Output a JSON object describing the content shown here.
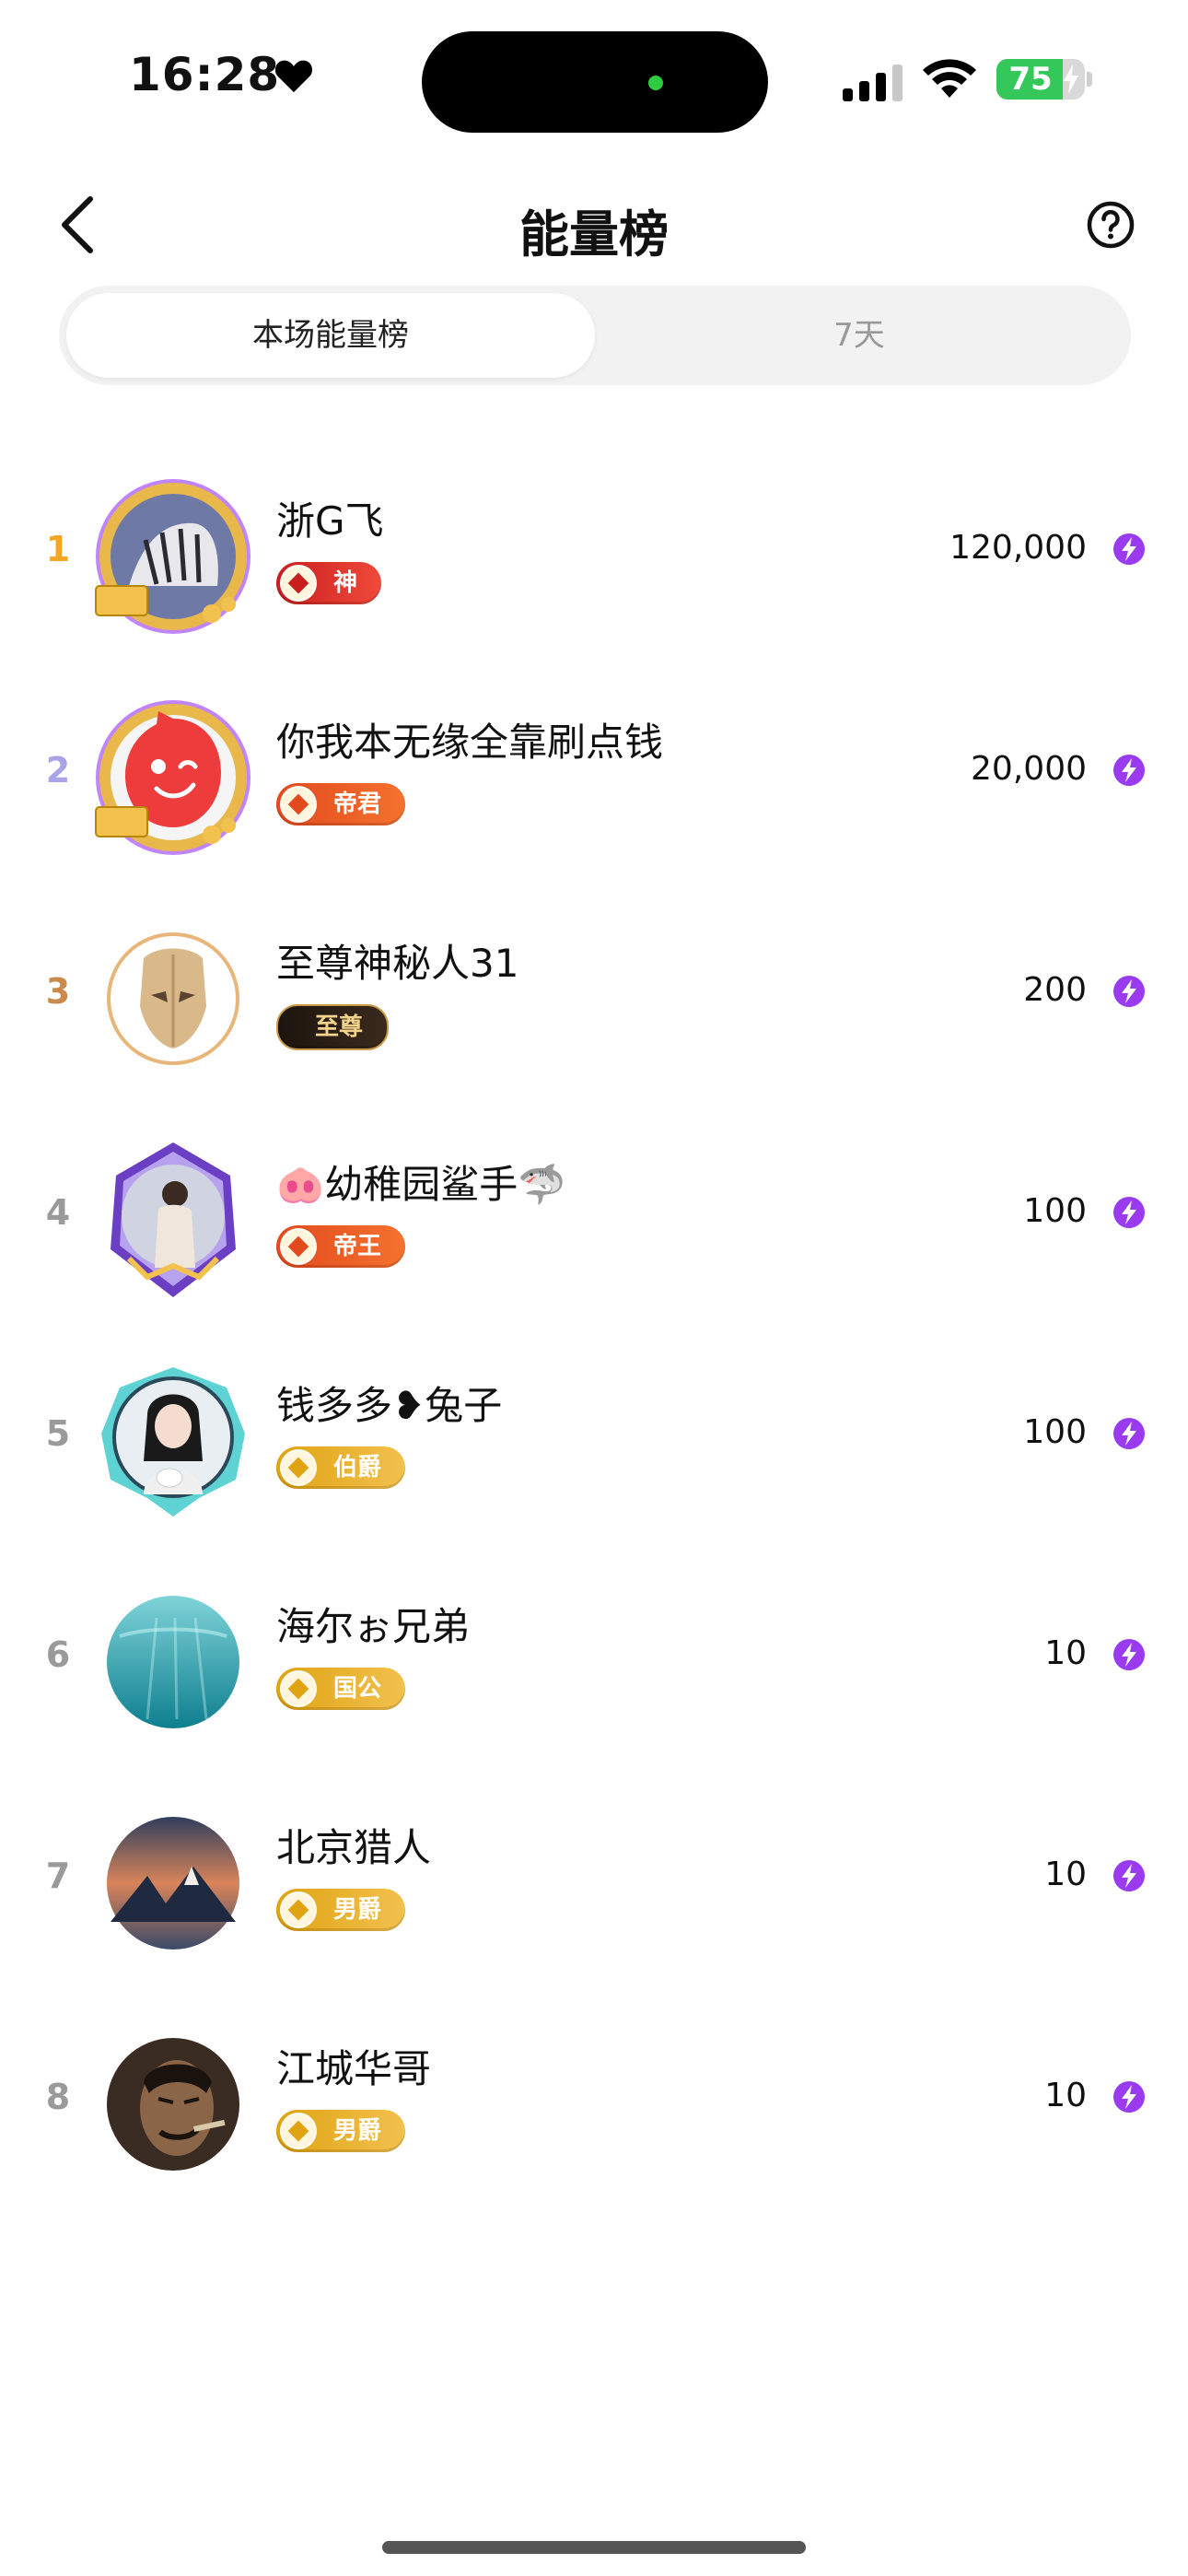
{
  "status_bar": {
    "time": "16:28",
    "battery": "75",
    "battery_level": 0.75
  },
  "header": {
    "title": "能量榜"
  },
  "tabs": [
    {
      "label": "本场能量榜",
      "active": true
    },
    {
      "label": "7天",
      "active": false
    }
  ],
  "rankings": [
    {
      "rank": "1",
      "name": "浙G飞",
      "badge": "神",
      "score": "120,000"
    },
    {
      "rank": "2",
      "name": "你我本无缘全靠刷点钱",
      "badge": "帝君",
      "score": "20,000"
    },
    {
      "rank": "3",
      "name": "至尊神秘人31",
      "badge": "至尊",
      "score": "200"
    },
    {
      "rank": "4",
      "name": "🐽幼稚园鲨手🦈",
      "badge": "帝王",
      "score": "100"
    },
    {
      "rank": "5",
      "name": "钱多多❥兔子",
      "badge": "伯爵",
      "score": "100"
    },
    {
      "rank": "6",
      "name": "海尔ぉ兄弟",
      "badge": "国公",
      "score": "10"
    },
    {
      "rank": "7",
      "name": "北京猎人",
      "badge": "男爵",
      "score": "10"
    },
    {
      "rank": "8",
      "name": "江城华哥",
      "badge": "男爵",
      "score": "10"
    }
  ],
  "colors": {
    "rank_1": "#f5a623",
    "rank_2": "#a9a3e8",
    "rank_3": "#c98a4b",
    "rank_other": "#9a9a9a",
    "energy_icon": "#9b3bf0",
    "battery": "#34c759",
    "badge_shen": "#e8322b",
    "badge_dijun": "#f0602a",
    "badge_zhizun": "#2b1d14",
    "badge_diwang": "#f0602a",
    "badge_gold": "#e6a817"
  }
}
